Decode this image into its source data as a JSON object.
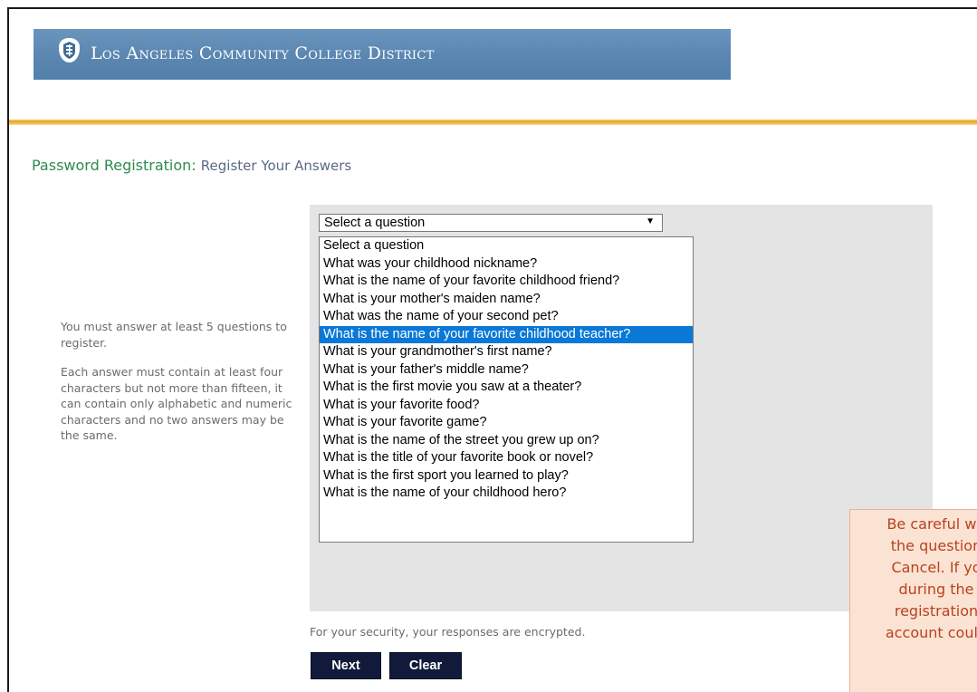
{
  "header": {
    "org_name": "Los Angeles Community College District",
    "seal_icon": "lacc-seal-icon"
  },
  "page": {
    "title_main": "Password Registration:",
    "title_sub": "Register Your Answers"
  },
  "instructions": {
    "line1": "You must answer at least 5 questions to register.",
    "line2": "Each answer must contain at least four characters but not more than fifteen, it can contain only alphabetic and numeric characters and no two answers may be the same."
  },
  "question_select": {
    "value": "Select a question",
    "options": [
      "Select a question",
      "What was your childhood nickname?",
      "What is the name of your favorite childhood friend?",
      "What is your mother's maiden name?",
      "What was the name of your second pet?",
      "What is the name of your favorite childhood teacher?",
      "What is your grandmother's first name?",
      "What is your father's middle name?",
      "What is the first movie you saw at a theater?",
      "What is your favorite food?",
      "What is your favorite game?",
      "What is the name of the street you grew up on?",
      "What is the title of your favorite book or novel?",
      "What is the first sport you learned to play?",
      "What is the name of your childhood hero?"
    ],
    "highlighted_index": 5
  },
  "footer": {
    "security_note": "For your security, your responses are encrypted."
  },
  "buttons": {
    "next": "Next",
    "clear": "Clear"
  },
  "callout": {
    "lines": [
      "Be careful wh",
      "the question",
      "Cancel.  If yo",
      "during the",
      "registration",
      "account could"
    ]
  },
  "colors": {
    "banner": "#5f8bb4",
    "gold_rule": "#e9a91f",
    "title_green": "#2e8b4e",
    "button": "#111a3a",
    "highlight": "#0a78d7",
    "callout_bg": "#fbe3d3",
    "callout_text": "#b8421f"
  }
}
